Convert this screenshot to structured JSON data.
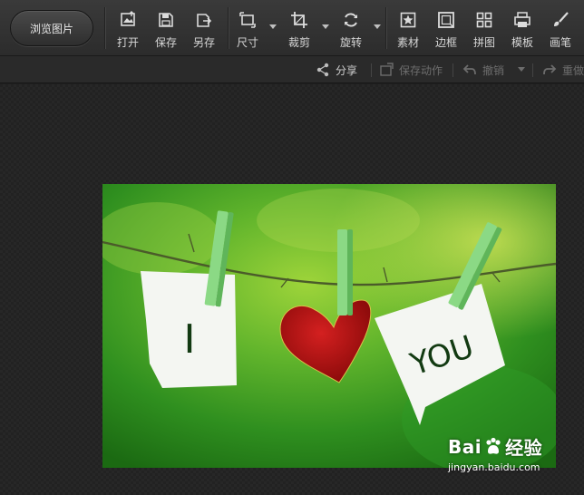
{
  "toolbar": {
    "browse_label": "浏览图片",
    "tools": [
      {
        "label": "打开",
        "icon": "open-icon"
      },
      {
        "label": "保存",
        "icon": "save-icon"
      },
      {
        "label": "另存",
        "icon": "save-as-icon"
      },
      {
        "label": "尺寸",
        "icon": "resize-icon",
        "has_menu": true
      },
      {
        "label": "裁剪",
        "icon": "crop-icon",
        "has_menu": true
      },
      {
        "label": "旋转",
        "icon": "rotate-icon",
        "has_menu": true
      },
      {
        "label": "素材",
        "icon": "material-icon"
      },
      {
        "label": "边框",
        "icon": "frame-icon"
      },
      {
        "label": "拼图",
        "icon": "collage-icon"
      },
      {
        "label": "模板",
        "icon": "template-icon"
      },
      {
        "label": "画笔",
        "icon": "brush-icon"
      }
    ]
  },
  "subbar": {
    "share_label": "分享",
    "save_action_label": "保存动作",
    "undo_label": "撤销",
    "redo_label": "重做"
  },
  "photo": {
    "note_left_text": "I",
    "note_right_text": "YOU"
  },
  "watermark": {
    "brand_prefix": "Bai",
    "brand_suffix": "经验",
    "url": "jingyan.baidu.com"
  },
  "colors": {
    "toolbar_bg": "#333333",
    "canvas_bg": "#222222",
    "photo_green": "#3fa32a",
    "heart_red": "#c41616",
    "peg_green": "#7fd37a"
  }
}
